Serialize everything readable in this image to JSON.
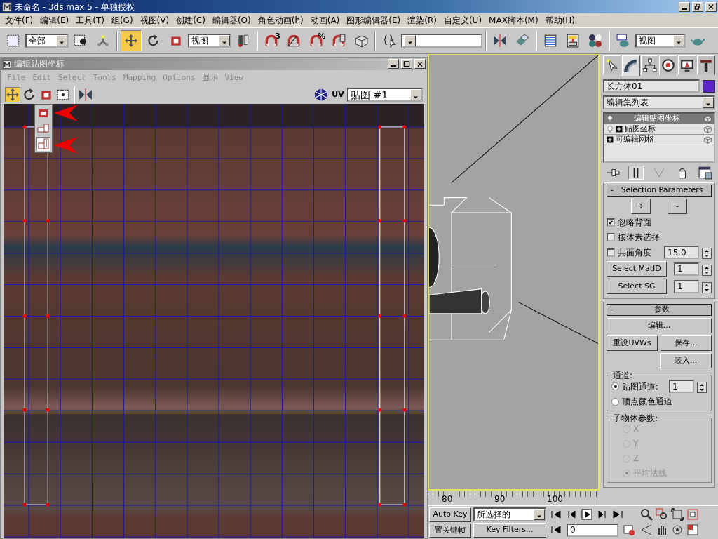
{
  "window": {
    "title": "未命名 - 3ds max 5 - 单独授权"
  },
  "menu": [
    {
      "label": "文件(F)"
    },
    {
      "label": "编辑(E)"
    },
    {
      "label": "工具(T)"
    },
    {
      "label": "组(G)"
    },
    {
      "label": "视图(V)"
    },
    {
      "label": "创建(C)"
    },
    {
      "label": "编辑器(O)"
    },
    {
      "label": "角色动画(h)"
    },
    {
      "label": "动画(A)"
    },
    {
      "label": "图形编辑器(E)"
    },
    {
      "label": "渲染(R)"
    },
    {
      "label": "自定义(U)"
    },
    {
      "label": "MAX脚本(M)"
    },
    {
      "label": "帮助(H)"
    }
  ],
  "toolbar": [
    {
      "kind": "region",
      "selected": false
    },
    {
      "kind": "dropdown",
      "value": "全部"
    },
    {
      "kind": "select-object",
      "selected": false
    },
    {
      "kind": "link",
      "selected": false
    },
    {
      "kind": "sep"
    },
    {
      "kind": "move",
      "selected": true
    },
    {
      "kind": "rotate",
      "selected": false
    },
    {
      "kind": "scale",
      "selected": false
    },
    {
      "kind": "dropdown",
      "value": "视图"
    },
    {
      "kind": "pivot",
      "selected": false
    },
    {
      "kind": "sep"
    },
    {
      "kind": "snap",
      "glyph": "3",
      "selected": false
    },
    {
      "kind": "angle-snap",
      "selected": false
    },
    {
      "kind": "snap",
      "glyph": "%",
      "selected": false
    },
    {
      "kind": "spinner-snap",
      "selected": false
    },
    {
      "kind": "box",
      "selected": false
    },
    {
      "kind": "sep"
    },
    {
      "kind": "named-sel",
      "selected": false
    },
    {
      "kind": "dropdown"
    },
    {
      "kind": "sep"
    },
    {
      "kind": "mirror",
      "selected": false
    },
    {
      "kind": "align",
      "selected": false
    },
    {
      "kind": "sep"
    },
    {
      "kind": "track",
      "selected": false
    },
    {
      "kind": "schematic",
      "selected": false
    },
    {
      "kind": "material",
      "selected": false
    },
    {
      "kind": "sep"
    },
    {
      "kind": "render-scene",
      "selected": false
    },
    {
      "kind": "dropdown",
      "value": "视图"
    },
    {
      "kind": "teapot",
      "selected": false
    }
  ],
  "uv_editor": {
    "title": "编辑贴图坐标",
    "menu": [
      {
        "label": "File"
      },
      {
        "label": "Edit"
      },
      {
        "label": "Select"
      },
      {
        "label": "Tools"
      },
      {
        "label": "Mapping"
      },
      {
        "label": "Options"
      },
      {
        "label": "显示"
      },
      {
        "label": "View"
      }
    ],
    "tools": [
      {
        "kind": "move",
        "selected": true
      },
      {
        "kind": "rotate",
        "selected": false
      },
      {
        "kind": "scale",
        "selected": false
      },
      {
        "kind": "freeform",
        "selected": false
      },
      {
        "kind": "sep"
      },
      {
        "kind": "mirror",
        "selected": false
      }
    ],
    "flyout": [
      {
        "kind": "scale",
        "selected": false
      },
      {
        "kind": "scale-h",
        "selected": false
      },
      {
        "kind": "scale-v",
        "selected": true
      }
    ],
    "uv_label": "UV",
    "map": "贴图 #1"
  },
  "timeline": {
    "ticks": [
      "80",
      "90",
      "100"
    ]
  },
  "command_panel": {
    "tabs": [
      {
        "kind": "create",
        "selected": false
      },
      {
        "kind": "modify",
        "selected": true
      },
      {
        "kind": "hierarchy",
        "selected": false
      },
      {
        "kind": "motion",
        "selected": false
      },
      {
        "kind": "display",
        "selected": false
      },
      {
        "kind": "utilities",
        "selected": false
      }
    ],
    "object_name": "长方体01",
    "modifier_list": "编辑集列表",
    "stack": [
      {
        "label": "编辑贴图坐标",
        "selected": true,
        "bulb": true,
        "expander": false
      },
      {
        "label": "贴图坐标",
        "selected": false,
        "bulb": true,
        "expander": true
      },
      {
        "label": "可编辑网格",
        "selected": false,
        "bulb": false,
        "expander": true
      }
    ],
    "stack_tools": [
      {
        "kind": "pin",
        "selected": false
      },
      {
        "kind": "show-end",
        "selected": true
      },
      {
        "kind": "unique",
        "selected": false
      },
      {
        "kind": "remove",
        "selected": false
      },
      {
        "kind": "configure",
        "selected": false
      }
    ],
    "selection_parameters": {
      "collapse": "-",
      "title": "Selection Parameters",
      "buttons": [
        "+",
        "-"
      ],
      "checks": [
        {
          "label": "忽略背面",
          "checked": true
        },
        {
          "label": "按体素选择",
          "checked": false
        },
        {
          "label": "共面角度",
          "checked": false,
          "value": "15.0"
        }
      ],
      "spinners": [
        {
          "button": "Select MatID",
          "value": "1"
        },
        {
          "button": "Select SG",
          "value": "1"
        }
      ]
    },
    "parameters": {
      "collapse": "-",
      "title": "参数",
      "edit": "编辑...",
      "reset": "重设UVWs",
      "save": "保存...",
      "load": "装入...",
      "channel": {
        "title": "通道:",
        "options": [
          {
            "label": "贴图通道:",
            "selected": true,
            "disabled": false,
            "value": "1"
          },
          {
            "label": "顶点颜色通道",
            "selected": false,
            "disabled": false
          }
        ]
      },
      "sub_object": {
        "title": "子物体参数:",
        "options": [
          {
            "label": "X",
            "selected": false,
            "disabled": true
          },
          {
            "label": "Y",
            "selected": false,
            "disabled": true
          },
          {
            "label": "Z",
            "selected": false,
            "disabled": true
          },
          {
            "label": "平均法线",
            "selected": true,
            "disabled": true
          }
        ]
      }
    }
  },
  "animation": {
    "auto_key": "Auto Key",
    "selection_set": "所选择的",
    "set_key": "置关键帧",
    "key_filters": "Key Filters...",
    "frame": "0"
  }
}
